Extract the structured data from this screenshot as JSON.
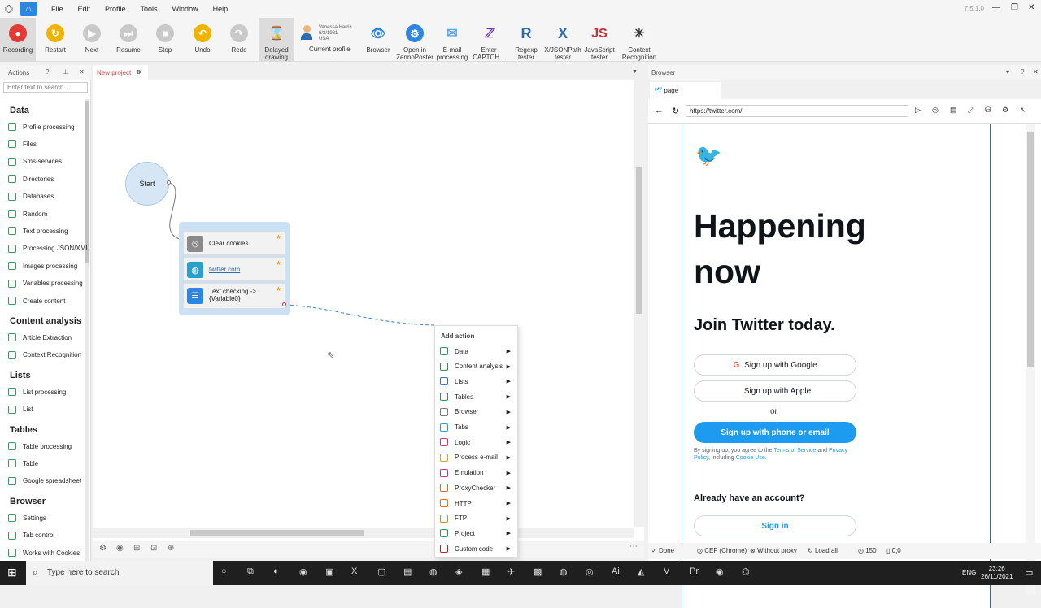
{
  "titlebar": {
    "menus": [
      "File",
      "Edit",
      "Profile",
      "Tools",
      "Window",
      "Help"
    ],
    "version": "7.5.1.0"
  },
  "toolbar": {
    "buttons": [
      {
        "label": "Recording",
        "icon": "record-icon",
        "color": "#e53935"
      },
      {
        "label": "Restart",
        "icon": "restart-icon",
        "color": "#f0b400"
      },
      {
        "label": "Next",
        "icon": "next-icon",
        "color": "#c9c9c9"
      },
      {
        "label": "Resume",
        "icon": "resume-icon",
        "color": "#c9c9c9"
      },
      {
        "label": "Stop",
        "icon": "stop-icon",
        "color": "#c9c9c9"
      },
      {
        "label": "Undo",
        "icon": "undo-icon",
        "color": "#f0b400"
      },
      {
        "label": "Redo",
        "icon": "redo-icon",
        "color": "#c9c9c9"
      },
      {
        "label": "Delayed drawing",
        "icon": "hourglass-icon",
        "color": "#555555"
      }
    ],
    "profile": {
      "name": "Vanessa Harris",
      "date": "6/3/1981",
      "country": "USA",
      "label": "Current profile"
    },
    "tools": [
      {
        "label": "Browser",
        "glyph": "👁"
      },
      {
        "label": "Open in ZennoPoster",
        "glyph": "⚙"
      },
      {
        "label": "E-mail processing",
        "glyph": "✉"
      },
      {
        "label": "Enter CAPTCH...",
        "glyph": "ℤ"
      },
      {
        "label": "Regexp tester",
        "glyph": "R"
      },
      {
        "label": "X/JSONPath tester",
        "glyph": "X"
      },
      {
        "label": "JavaScript tester",
        "glyph": "JS"
      },
      {
        "label": "Context Recognition",
        "glyph": "✳"
      }
    ]
  },
  "actions_panel": {
    "title": "Actions",
    "search_placeholder": "Enter text to search...",
    "categories": [
      {
        "name": "Data",
        "items": [
          "Profile processing",
          "Files",
          "Sms-services",
          "Directories",
          "Databases",
          "Random",
          "Text processing",
          "Processing JSON/XML",
          "Images processing",
          "Variables processing",
          "Create content"
        ]
      },
      {
        "name": "Content analysis",
        "items": [
          "Article Extraction",
          "Context Recognition"
        ]
      },
      {
        "name": "Lists",
        "items": [
          "List processing",
          "List"
        ]
      },
      {
        "name": "Tables",
        "items": [
          "Table processing",
          "Table",
          "Google spreadsheet"
        ]
      },
      {
        "name": "Browser",
        "items": [
          "Settings",
          "Tab control",
          "Works with Cookies"
        ]
      }
    ]
  },
  "project": {
    "tab_label": "New project",
    "start_label": "Start",
    "nodes": [
      "Clear cookies",
      "twitter.com",
      "Text checking -> {Variable0}"
    ]
  },
  "context_menu": {
    "title": "Add action",
    "items": [
      {
        "label": "Data",
        "color": "#2f8f55"
      },
      {
        "label": "Content analysis",
        "color": "#2f8f55"
      },
      {
        "label": "Lists",
        "color": "#3a6fc4"
      },
      {
        "label": "Tables",
        "color": "#2f8f55"
      },
      {
        "label": "Browser",
        "color": "#777777"
      },
      {
        "label": "Tabs",
        "color": "#2aa0c8"
      },
      {
        "label": "Logic",
        "color": "#c0357a"
      },
      {
        "label": "Process e-mail",
        "color": "#e0a020"
      },
      {
        "label": "Emulation",
        "color": "#c0357a"
      },
      {
        "label": "ProxyChecker",
        "color": "#c07020"
      },
      {
        "label": "HTTP",
        "color": "#e07020"
      },
      {
        "label": "FTP",
        "color": "#c09020"
      },
      {
        "label": "Project",
        "color": "#2f8f55"
      },
      {
        "label": "Custom code",
        "color": "#c0202a"
      }
    ]
  },
  "browser": {
    "panel_title": "Browser",
    "tab_label": "page",
    "url": "https://twitter.com/",
    "twitter": {
      "headline1": "Happening",
      "headline2": "now",
      "join": "Join Twitter today.",
      "google": "Sign up with Google",
      "apple": "Sign up with Apple",
      "or": "or",
      "phone": "Sign up with phone or email",
      "terms_prefix": "By signing up, you agree to the ",
      "terms_link": "Terms of Service",
      "terms_mid": " and ",
      "privacy_link": "Privacy Policy",
      "terms_mid2": ", including ",
      "cookie_link": "Cookie Use.",
      "have_account": "Already have an account?",
      "sign_in": "Sign in",
      "accent": "#1d9bf0"
    }
  },
  "status": {
    "done": "Done",
    "engine": "CEF (Chrome)",
    "proxy": "Without proxy",
    "load": "Load all",
    "count": "150",
    "coords": "0;0"
  },
  "taskbar": {
    "search_placeholder": "Type here to search",
    "lang": "ENG",
    "time": "23:26",
    "date": "26/11/2021"
  }
}
